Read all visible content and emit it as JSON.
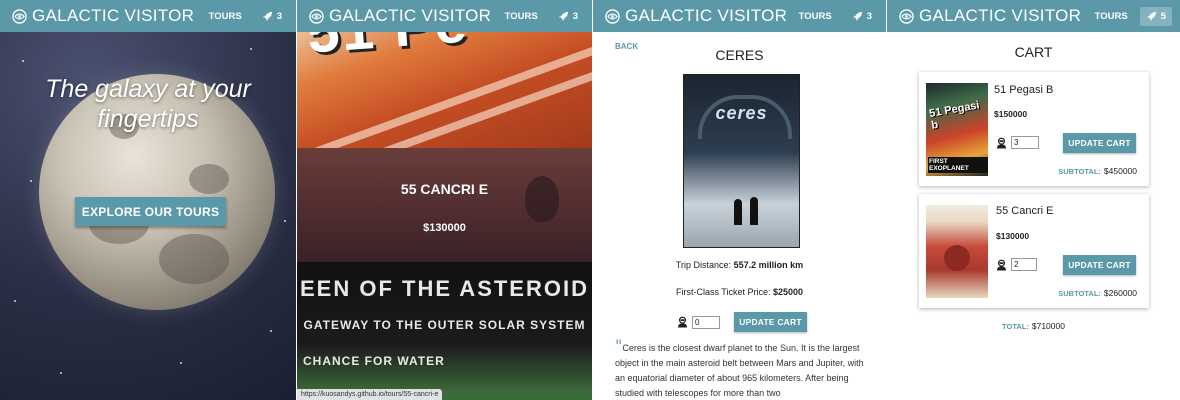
{
  "brand": {
    "name": "GALACTIC VISITOR"
  },
  "nav": {
    "tours_label": "TOURS",
    "cart_count_home": "3",
    "cart_count_tours": "3",
    "cart_count_detail": "3",
    "cart_count_cart": "5"
  },
  "colors": {
    "accent": "#5b99a8"
  },
  "home": {
    "headline": "The galaxy at your fingertips",
    "cta": "EXPLORE OUR TOURS"
  },
  "tours": {
    "featured_name": "55 CANCRI E",
    "featured_price": "$130000",
    "poster_top_text": "51 Pe",
    "poster_lines": [
      "EEN OF THE ASTEROID",
      "GATEWAY TO THE OUTER SOLAR SYSTEM",
      "CHANCE FOR WATER"
    ],
    "status_url": "https://kuosandys.github.io/tours/55-cancri-e"
  },
  "detail": {
    "back": "BACK",
    "name": "CERES",
    "poster_title": "ceres",
    "trip_distance_label": "Trip Distance:",
    "trip_distance_value": "557.2 million km",
    "ticket_label": "First-Class Ticket Price:",
    "ticket_value": "$25000",
    "qty": "0",
    "update_label": "UPDATE CART",
    "description": "Ceres is the closest dwarf planet to the Sun. It is the largest object in the main asteroid belt between Mars and Jupiter, with an equatorial diameter of about 965 kilometers. After being studied with telescopes for more than two"
  },
  "cart": {
    "title": "CART",
    "items": [
      {
        "name": "51 Pegasi B",
        "price": "$150000",
        "qty": "3",
        "update_label": "UPDATE CART",
        "subtotal_label": "SUBTOTAL:",
        "subtotal": "$450000",
        "poster_text": "51 Pegasi b",
        "poster_caption": "FIRST EXOPLANET"
      },
      {
        "name": "55 Cancri E",
        "price": "$130000",
        "qty": "2",
        "update_label": "UPDATE CART",
        "subtotal_label": "SUBTOTAL:",
        "subtotal": "$260000"
      }
    ],
    "total_label": "TOTAL:",
    "total": "$710000"
  },
  "icons": {
    "logo": "galaxy-logo-icon",
    "cart": "rocket-icon",
    "traveler": "astronaut-icon"
  }
}
